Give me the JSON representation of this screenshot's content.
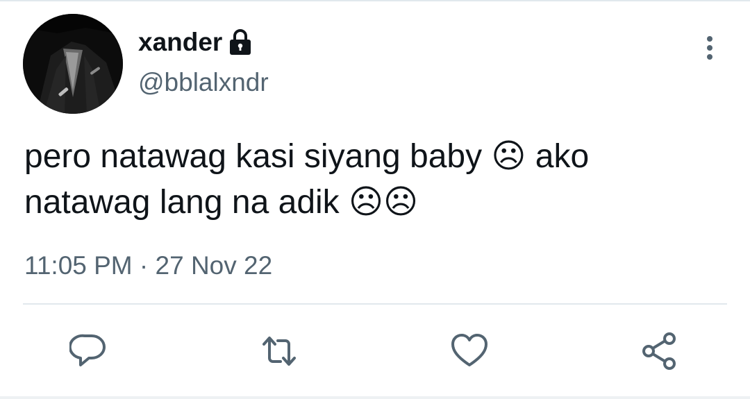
{
  "tweet": {
    "display_name": "xander",
    "handle": "@bblalxndr",
    "text": "pero natawag kasi siyang baby ☹ ako natawag lang na adik ☹☹",
    "timestamp": "11:05 PM · 27 Nov 22",
    "protected": true
  },
  "icons": {
    "protected": "lock-icon",
    "menu": "more-vertical-icon",
    "reply": "reply-icon",
    "retweet": "retweet-icon",
    "like": "heart-icon",
    "share": "share-icon"
  },
  "colors": {
    "text_primary": "#0f1419",
    "text_secondary": "#536471",
    "icon": "#536471",
    "divider": "#e1e8ed"
  }
}
